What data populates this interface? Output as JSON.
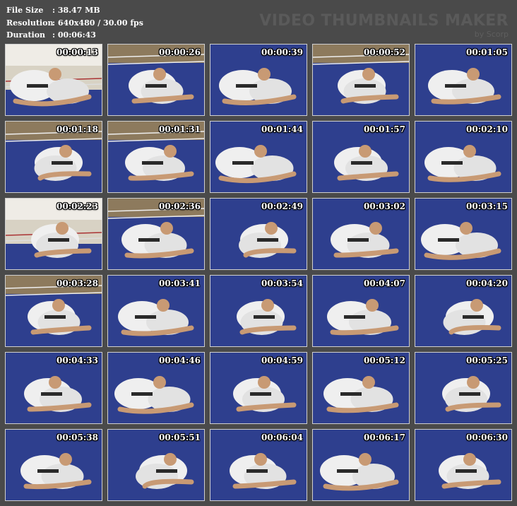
{
  "info": {
    "file_size_label": "File Size",
    "file_size_value": ":  38.47 MB",
    "resolution_label": "Resolution",
    "resolution_value": ":  640x480 / 30.00 fps",
    "duration_label": "Duration",
    "duration_value": ":  00:06:43"
  },
  "brand": {
    "title": "VIDEO THUMBNAILS MAKER",
    "subtitle": "by Scorp"
  },
  "colors": {
    "mat_blue": "#2e3f8e",
    "gi_white": "#efefef",
    "skin": "#c89a74",
    "wall": "#d8d2c4",
    "belt": "#2a2a2a"
  },
  "thumbnails": [
    {
      "time": "00:00:13",
      "scene": "room"
    },
    {
      "time": "00:00:26",
      "scene": "ring"
    },
    {
      "time": "00:00:39",
      "scene": "mat"
    },
    {
      "time": "00:00:52",
      "scene": "ring"
    },
    {
      "time": "00:01:05",
      "scene": "mat"
    },
    {
      "time": "00:01:18",
      "scene": "ring"
    },
    {
      "time": "00:01:31",
      "scene": "ring"
    },
    {
      "time": "00:01:44",
      "scene": "mat"
    },
    {
      "time": "00:01:57",
      "scene": "mat"
    },
    {
      "time": "00:02:10",
      "scene": "mat"
    },
    {
      "time": "00:02:23",
      "scene": "room"
    },
    {
      "time": "00:02:36",
      "scene": "ring"
    },
    {
      "time": "00:02:49",
      "scene": "mat"
    },
    {
      "time": "00:03:02",
      "scene": "mat"
    },
    {
      "time": "00:03:15",
      "scene": "mat"
    },
    {
      "time": "00:03:28",
      "scene": "ring"
    },
    {
      "time": "00:03:41",
      "scene": "mat"
    },
    {
      "time": "00:03:54",
      "scene": "mat"
    },
    {
      "time": "00:04:07",
      "scene": "mat"
    },
    {
      "time": "00:04:20",
      "scene": "mat"
    },
    {
      "time": "00:04:33",
      "scene": "mat"
    },
    {
      "time": "00:04:46",
      "scene": "mat"
    },
    {
      "time": "00:04:59",
      "scene": "mat"
    },
    {
      "time": "00:05:12",
      "scene": "mat"
    },
    {
      "time": "00:05:25",
      "scene": "mat"
    },
    {
      "time": "00:05:38",
      "scene": "mat"
    },
    {
      "time": "00:05:51",
      "scene": "mat"
    },
    {
      "time": "00:06:04",
      "scene": "mat"
    },
    {
      "time": "00:06:17",
      "scene": "mat"
    },
    {
      "time": "00:06:30",
      "scene": "mat"
    }
  ]
}
